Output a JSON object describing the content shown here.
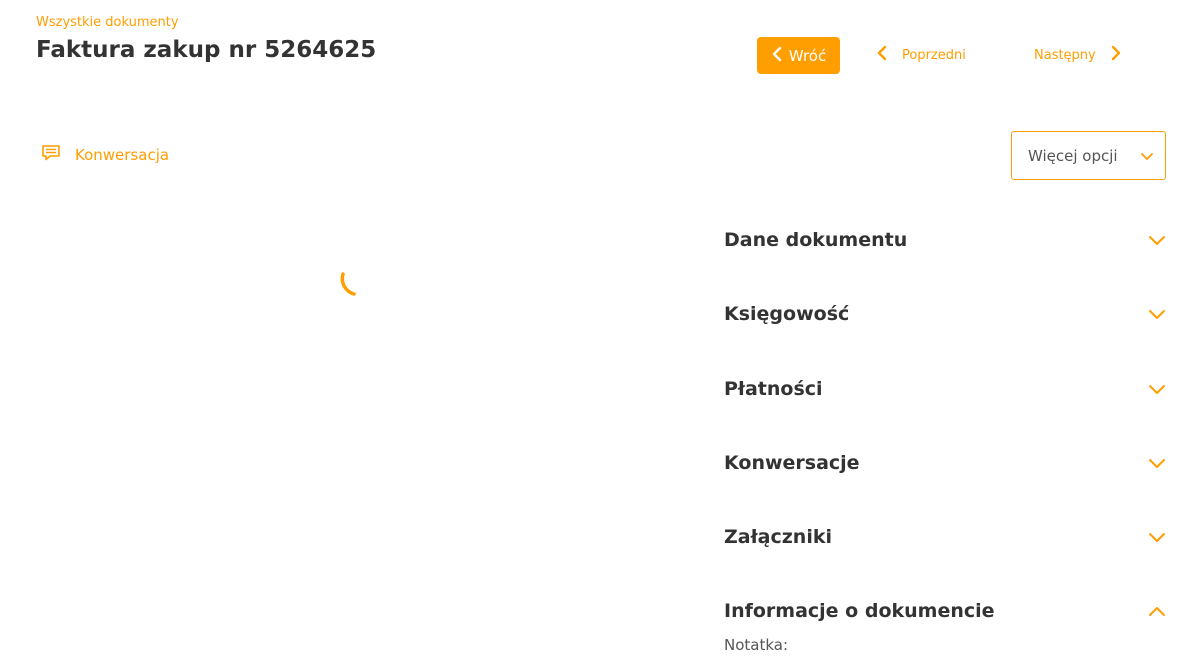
{
  "header": {
    "breadcrumb": "Wszystkie dokumenty",
    "title": "Faktura zakup nr 5264625"
  },
  "navigation": {
    "back_label": "Wróć",
    "prev_label": "Poprzedni",
    "next_label": "Następny"
  },
  "toolbar": {
    "conversation_label": "Konwersacja",
    "more_options_label": "Więcej opcji"
  },
  "sections": [
    {
      "title": "Dane dokumentu",
      "expanded": false
    },
    {
      "title": "Księgowość",
      "expanded": false
    },
    {
      "title": "Płatności",
      "expanded": false
    },
    {
      "title": "Konwersacje",
      "expanded": false
    },
    {
      "title": "Załączniki",
      "expanded": false
    },
    {
      "title": "Informacje o dokumencie",
      "expanded": true
    }
  ],
  "document_info": {
    "note_label": "Notatka:"
  },
  "colors": {
    "accent": "#FF9E00",
    "text": "#333333",
    "muted": "#555555"
  },
  "icons": {
    "back": "chevron-left-icon",
    "prev": "chevron-left-icon",
    "next": "chevron-right-icon",
    "conversation": "chat-icon",
    "dropdown": "chevron-down-icon",
    "loading": "loading-spinner-icon"
  }
}
